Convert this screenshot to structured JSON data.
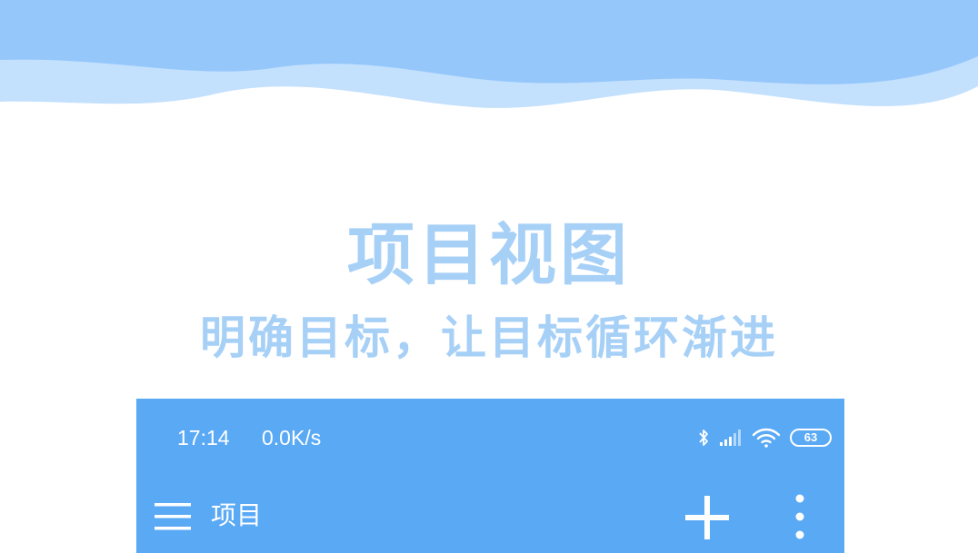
{
  "hero": {
    "title": "项目视图",
    "subtitle": "明确目标，让目标循环渐进"
  },
  "phone": {
    "status_bar": {
      "time": "17:14",
      "network_speed": "0.0K/s",
      "battery_level": "63",
      "icons": [
        "bluetooth-icon",
        "signal-icon",
        "wifi-icon",
        "battery-icon"
      ]
    },
    "toolbar": {
      "title": "项目",
      "menu_icon": "hamburger-menu-icon",
      "add_icon": "plus-icon",
      "more_icon": "more-vertical-icon"
    }
  },
  "colors": {
    "accent": "#5aa9f5",
    "wave_light": "#c3e0fd",
    "wave_mid": "#95c7fb",
    "text_light": "#a7d0f7"
  }
}
